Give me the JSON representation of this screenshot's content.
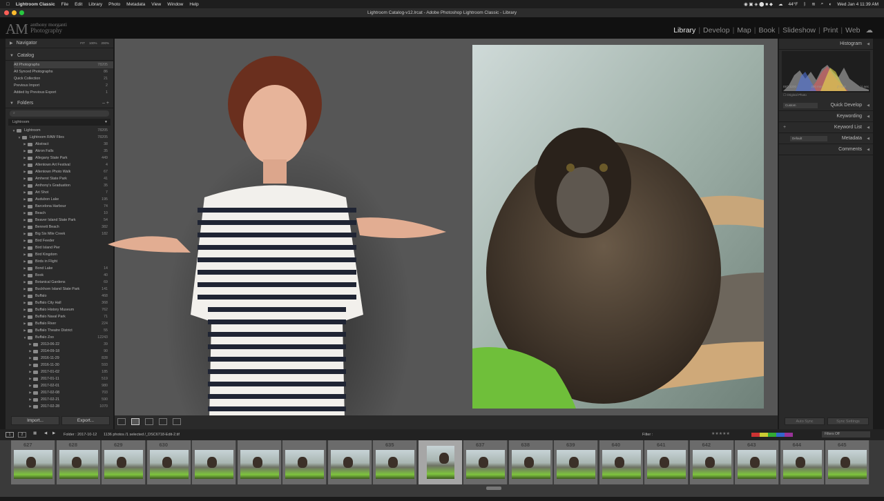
{
  "menubar": {
    "app": "Lightroom Classic",
    "items": [
      "File",
      "Edit",
      "Library",
      "Photo",
      "Metadata",
      "View",
      "Window",
      "Help"
    ],
    "weather": "44°F",
    "datetime": "Wed Jan 4  11:39 AM"
  },
  "window_title": "Lightroom Catalog-v12.lrcat - Adobe Photoshop Lightroom Classic - Library",
  "identity": {
    "mark": "AM",
    "line1": "anthony morganti",
    "line2": "Photography"
  },
  "modules": [
    "Library",
    "Develop",
    "Map",
    "Book",
    "Slideshow",
    "Print",
    "Web"
  ],
  "active_module": "Library",
  "left": {
    "navigator": {
      "label": "Navigator",
      "zoom": [
        "FIT",
        "100%",
        "200%"
      ]
    },
    "catalog": {
      "label": "Catalog",
      "items": [
        {
          "name": "All Photographs",
          "count": "78205"
        },
        {
          "name": "All Synced Photographs",
          "count": "86"
        },
        {
          "name": "Quick Collection",
          "count": "21"
        },
        {
          "name": "Previous Import",
          "count": "2"
        },
        {
          "name": "Added by Previous Export",
          "count": "1"
        }
      ]
    },
    "folders": {
      "label": "Folders",
      "volume": "Lightroom",
      "root": {
        "name": "Lightroom",
        "count": "78205"
      },
      "raw": {
        "name": "Lightroom RAW Files",
        "count": "78205"
      },
      "items": [
        {
          "name": "Abstract",
          "count": "38"
        },
        {
          "name": "Akron Falls",
          "count": "35"
        },
        {
          "name": "Allegany State Park",
          "count": "449"
        },
        {
          "name": "Allentown Art Festival",
          "count": "4"
        },
        {
          "name": "Allentown Photo Walk",
          "count": "67"
        },
        {
          "name": "Amherst State Park",
          "count": "41"
        },
        {
          "name": "Anthony's Graduation",
          "count": "35"
        },
        {
          "name": "Art Shot",
          "count": "7"
        },
        {
          "name": "Audubon Lake",
          "count": "195"
        },
        {
          "name": "Barcelona Harbour",
          "count": "74"
        },
        {
          "name": "Beach",
          "count": "10"
        },
        {
          "name": "Beaver Island State Park",
          "count": "54"
        },
        {
          "name": "Bennett Beach",
          "count": "382"
        },
        {
          "name": "Big Six Mile Creek",
          "count": "182"
        },
        {
          "name": "Bird Feeder",
          "count": ""
        },
        {
          "name": "Bird Island Pier",
          "count": ""
        },
        {
          "name": "Bird Kingdom",
          "count": ""
        },
        {
          "name": "Birds in Flight",
          "count": ""
        },
        {
          "name": "Bond Lake",
          "count": "14"
        },
        {
          "name": "Book",
          "count": "40"
        },
        {
          "name": "Botanical Gardens",
          "count": "69"
        },
        {
          "name": "Buckhorn Island State Park",
          "count": "141"
        },
        {
          "name": "Buffalo",
          "count": "468"
        },
        {
          "name": "Buffalo City Hall",
          "count": "368"
        },
        {
          "name": "Buffalo History Museum",
          "count": "762"
        },
        {
          "name": "Buffalo Naval Park",
          "count": "71"
        },
        {
          "name": "Buffalo River",
          "count": "224"
        },
        {
          "name": "Buffalo Theatre District",
          "count": "55"
        },
        {
          "name": "Buffalo Zoo",
          "count": "12243"
        }
      ],
      "sub": [
        {
          "name": "2013-06-22",
          "count": "39"
        },
        {
          "name": "2014-09-18",
          "count": "90"
        },
        {
          "name": "2016-11-29",
          "count": "828"
        },
        {
          "name": "2016-11-30",
          "count": "593"
        },
        {
          "name": "2017-01-02",
          "count": "185"
        },
        {
          "name": "2017-01-11",
          "count": "519"
        },
        {
          "name": "2017-02-01",
          "count": "980"
        },
        {
          "name": "2017-02-08",
          "count": "703"
        },
        {
          "name": "2017-02-21",
          "count": "590"
        },
        {
          "name": "2017-02-28",
          "count": "1070"
        }
      ]
    },
    "import_btn": "Import...",
    "export_btn": "Export..."
  },
  "right": {
    "histogram": {
      "label": "Histogram",
      "iso": "ISO 3200",
      "focal": "200 mm",
      "aperture": "ƒ / 8.0",
      "shutter": "½ sec",
      "original_photo": "Original Photo"
    },
    "quick_develop": {
      "preset": "Custom",
      "label": "Quick Develop"
    },
    "keywording": "Keywording",
    "keyword_list": "Keyword List",
    "metadata": {
      "preset": "Default",
      "label": "Metadata"
    },
    "comments": "Comments",
    "auto_sync": "Auto Sync",
    "sync_settings": "Sync Settings"
  },
  "filmbar": {
    "folder": "Folder : 2017-10-12",
    "info": "1136 photos /1 selected /_DSC6718-Edit-2.tif",
    "filter_label": "Filter :",
    "filters_off": "Filters Off"
  },
  "filmstrip": {
    "numbers": [
      "627",
      "628",
      "629",
      "630",
      "",
      "",
      "",
      "",
      "635",
      "",
      "637",
      "638",
      "639",
      "640",
      "641",
      "642",
      "643",
      "644",
      "645"
    ]
  },
  "colors": {
    "accent": "#e8e8e8",
    "panel": "#2a2a2a",
    "background": "#565656"
  }
}
